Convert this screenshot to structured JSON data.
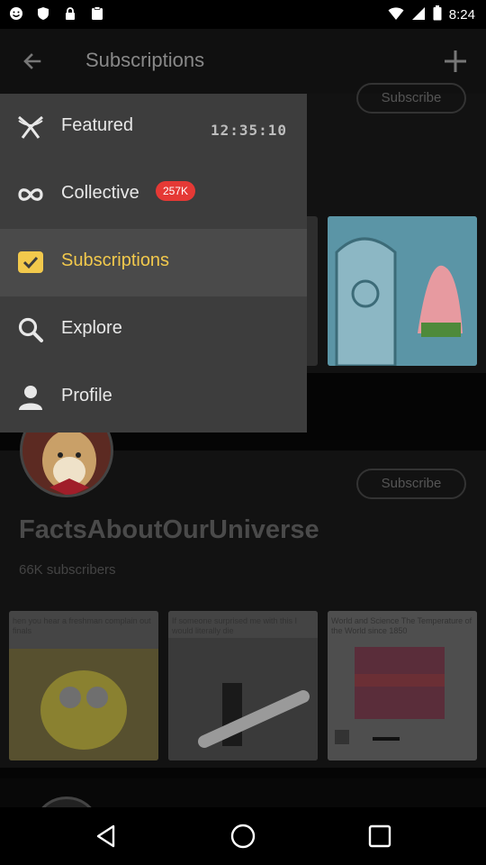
{
  "status_bar": {
    "time": "8:24",
    "left_icons": [
      "smiley-icon",
      "shield-icon",
      "lock-icon",
      "clipboard-icon"
    ],
    "right_icons": [
      "wifi-icon",
      "signal-icon",
      "battery-icon"
    ]
  },
  "app_bar": {
    "title": "Subscriptions",
    "back_icon": "arrow-back-icon",
    "add_icon": "plus-icon"
  },
  "drawer": {
    "items": [
      {
        "label": "Featured",
        "icon": "featured-icon",
        "extra": "12:35:10"
      },
      {
        "label": "Collective",
        "icon": "infinity-icon",
        "badge": "257K"
      },
      {
        "label": "Subscriptions",
        "icon": "checkbox-icon",
        "selected": true
      },
      {
        "label": "Explore",
        "icon": "search-icon"
      },
      {
        "label": "Profile",
        "icon": "person-icon"
      }
    ]
  },
  "channels": [
    {
      "name": "FactsAboutOurUniverse",
      "subscribers": "66K subscribers",
      "subscribe_label": "Subscribe",
      "thumb_captions": [
        "hen you hear a freshman complain out finals",
        "If someone surprised me with this I would literally die",
        "World and Science The Temperature of the World since 1850"
      ]
    }
  ],
  "top_card": {
    "subscribe_label": "Subscribe"
  },
  "nav_bar": {
    "buttons": [
      "back-nav-icon",
      "home-nav-icon",
      "recents-nav-icon"
    ]
  },
  "colors": {
    "accent": "#f2c94c",
    "badge": "#e53935",
    "drawer_bg": "#3d3d3d"
  }
}
